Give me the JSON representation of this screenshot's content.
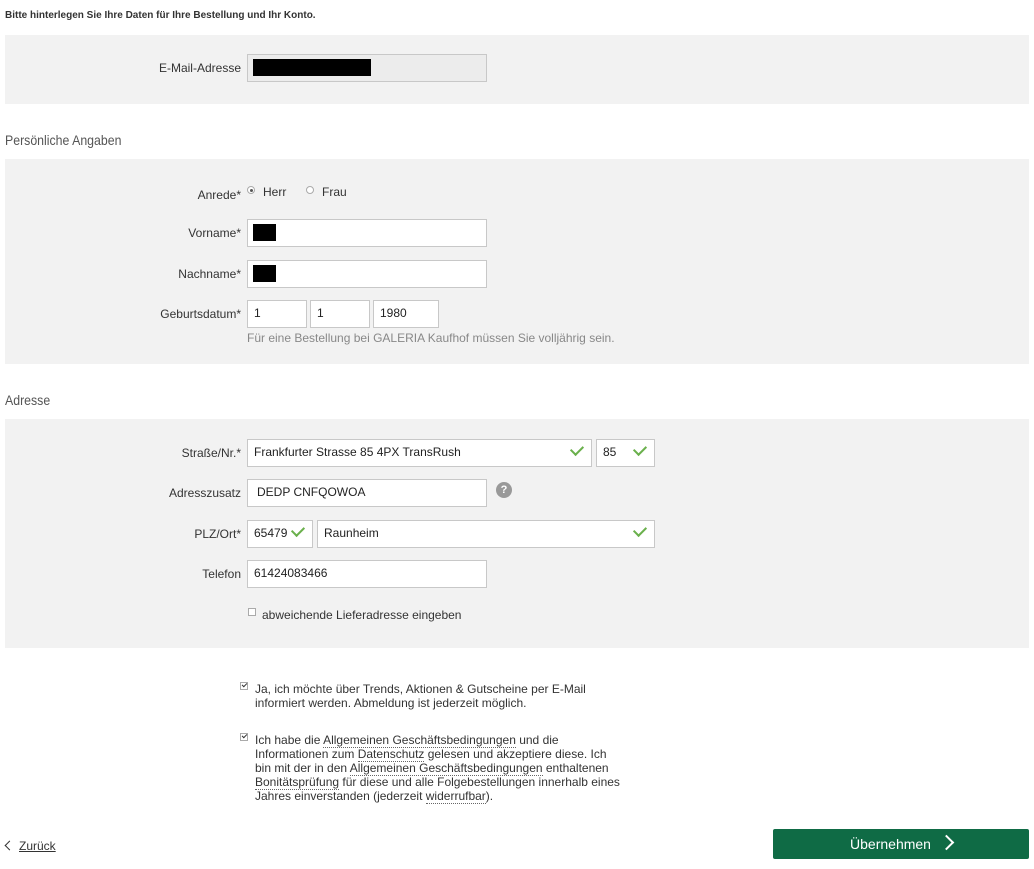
{
  "intro": "Bitte hinterlegen Sie Ihre Daten für Ihre Bestellung und Ihr Konto.",
  "account": {
    "email_label": "E-Mail-Adresse"
  },
  "personal": {
    "section_title": "Persönliche Angaben",
    "salutation_label": "Anrede*",
    "salutation_options": [
      "Herr",
      "Frau"
    ],
    "salutation_selected": "Herr",
    "firstname_label": "Vorname*",
    "lastname_label": "Nachname*",
    "birthdate_label": "Geburtsdatum*",
    "birth_day": "1",
    "birth_month": "1",
    "birth_year": "1980",
    "birthdate_hint": "Für eine Bestellung bei GALERIA Kaufhof müssen Sie volljährig sein."
  },
  "address": {
    "section_title": "Adresse",
    "street_label": "Straße/Nr.*",
    "street": "Frankfurter Strasse 85 4PX TransRush",
    "house_number": "85",
    "addition_label": "Adresszusatz",
    "addition": "DEDP CNFQOWOA",
    "zip_city_label": "PLZ/Ort*",
    "zip": "65479",
    "city": "Raunheim",
    "phone_label": "Telefon",
    "phone": "61424083466",
    "alt_delivery_label": "abweichende Lieferadresse eingeben"
  },
  "consents": {
    "newsletter_text": "Ja, ich möchte über Trends, Aktionen & Gutscheine per E-Mail informiert werden. Abmeldung ist jederzeit möglich.",
    "terms_1": "Ich habe die ",
    "terms_link_agb": "Allgemeinen Geschäftsbedingungen",
    "terms_2": " und die Informationen zum ",
    "terms_link_privacy": "Datenschutz",
    "terms_3": " gelesen und akzeptiere diese. Ich bin mit der in den ",
    "terms_link_agb2": "Allgemeinen Geschäftsbedingungen",
    "terms_4": " enthaltenen ",
    "terms_link_credit": "Bonitätsprüfung",
    "terms_5": " für diese und alle Folgebestellungen innerhalb eines Jahres einverstanden (jederzeit ",
    "terms_link_revoke": "widerrufbar",
    "terms_6": ")."
  },
  "nav": {
    "back_label": "Zurück",
    "submit_label": "Übernehmen"
  },
  "colors": {
    "primary_button": "#0f6b45",
    "valid_check": "#6ab04c",
    "panel_bg": "#f2f2f2"
  }
}
